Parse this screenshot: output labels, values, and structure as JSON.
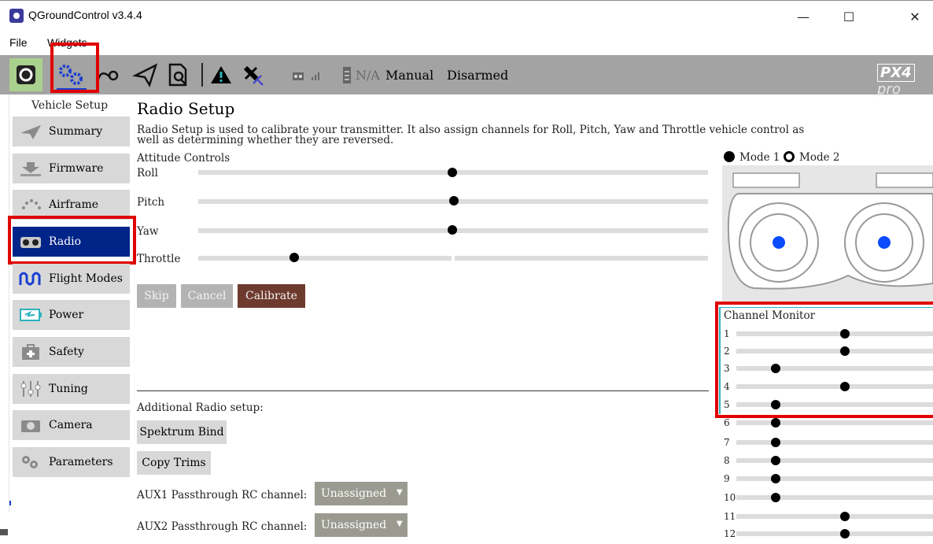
{
  "window": {
    "title": "QGroundControl v3.4.4",
    "minimize": "—",
    "maximize": "☐",
    "close": "✕"
  },
  "menu": {
    "file": "File",
    "widgets": "Widgets"
  },
  "toolbar": {
    "battery": "N/A",
    "flight_mode": "Manual",
    "arm_state": "Disarmed",
    "brand": "PX4",
    "brand_suffix": "pro"
  },
  "sidebar": {
    "header": "Vehicle Setup",
    "items": [
      {
        "label": "Summary",
        "icon": "paper-plane-icon"
      },
      {
        "label": "Firmware",
        "icon": "download-icon"
      },
      {
        "label": "Airframe",
        "icon": "airframe-icon"
      },
      {
        "label": "Radio",
        "icon": "radio-icon"
      },
      {
        "label": "Flight Modes",
        "icon": "waveform-icon"
      },
      {
        "label": "Power",
        "icon": "battery-icon"
      },
      {
        "label": "Safety",
        "icon": "medkit-icon"
      },
      {
        "label": "Tuning",
        "icon": "tuning-sliders-icon"
      },
      {
        "label": "Camera",
        "icon": "camera-icon"
      },
      {
        "label": "Parameters",
        "icon": "gears-icon"
      }
    ],
    "active": "Radio"
  },
  "main": {
    "title": "Radio Setup",
    "description_line1": "Radio Setup is used to calibrate your transmitter. It also assign channels for Roll, Pitch, Yaw and Throttle vehicle control as",
    "description_line2": "well as determining whether they are reversed.",
    "attitude_title": "Attitude Controls",
    "controls": [
      {
        "label": "Roll",
        "value": 0.5
      },
      {
        "label": "Pitch",
        "value": 0.5
      },
      {
        "label": "Yaw",
        "value": 0.5
      },
      {
        "label": "Throttle",
        "value": 0.2
      }
    ],
    "buttons": {
      "skip": "Skip",
      "cancel": "Cancel",
      "calibrate": "Calibrate"
    },
    "additional_title": "Additional Radio setup:",
    "spektrum_bind": "Spektrum Bind",
    "copy_trims": "Copy Trims",
    "aux1_label": "AUX1 Passthrough RC channel:",
    "aux1_value": "Unassigned",
    "aux2_label": "AUX2 Passthrough RC channel:",
    "aux2_value": "Unassigned"
  },
  "modes": {
    "mode1": "Mode 1",
    "mode2": "Mode 2",
    "selected": "Mode 2"
  },
  "channel_monitor": {
    "title": "Channel Monitor",
    "channels": [
      {
        "n": "1",
        "value": 0.55
      },
      {
        "n": "2",
        "value": 0.55
      },
      {
        "n": "3",
        "value": 0.2
      },
      {
        "n": "4",
        "value": 0.55
      },
      {
        "n": "5",
        "value": 0.2
      },
      {
        "n": "6",
        "value": 0.2
      },
      {
        "n": "7",
        "value": 0.2
      },
      {
        "n": "8",
        "value": 0.2
      },
      {
        "n": "9",
        "value": 0.2
      },
      {
        "n": "10",
        "value": 0.2
      },
      {
        "n": "11",
        "value": 0.55
      },
      {
        "n": "12",
        "value": 0.55
      }
    ]
  },
  "colors": {
    "active_sidebar": "#002488",
    "calibrate_button": "#6e3a2e",
    "disabled_button": "#b3b3b3",
    "highlight": "#e00000",
    "stick_dot": "#0a4bff"
  }
}
